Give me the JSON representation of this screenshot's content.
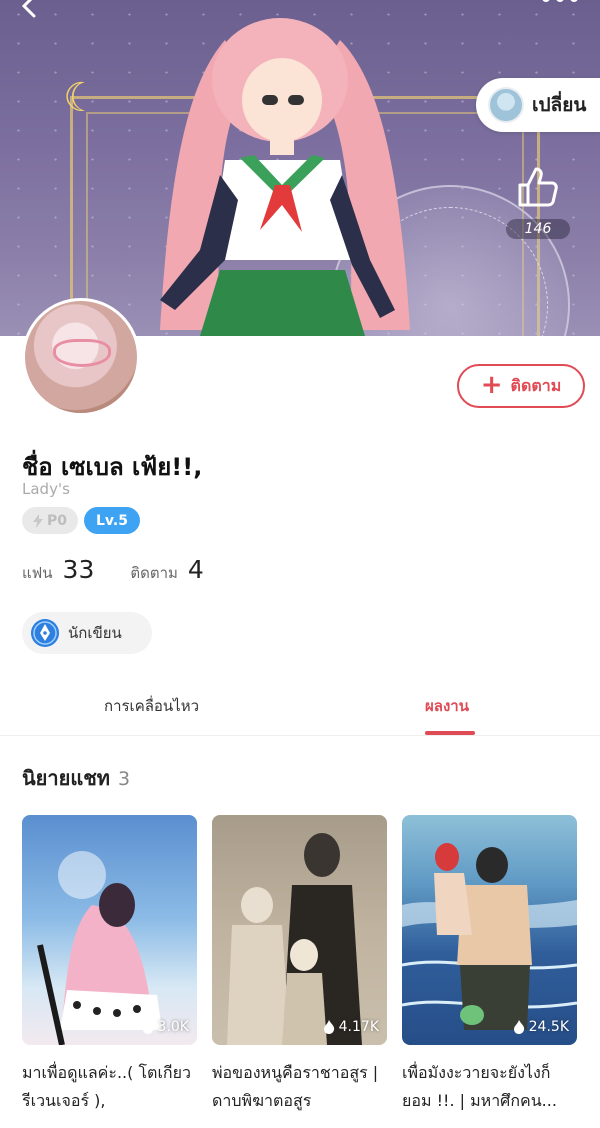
{
  "header": {
    "switch_label": "เปลี่ยน",
    "like_count": "146"
  },
  "profile": {
    "name": "ชื่อ เซเบล เฟ้ย!!,",
    "subtitle": "Lady's",
    "badge_power": "P0",
    "badge_level": "Lv.5",
    "follow_label": "ติดตาม",
    "fans_label": "แฟน",
    "fans_count": "33",
    "following_label": "ติดตาม",
    "following_count": "4",
    "role_label": "นักเขียน"
  },
  "tabs": [
    {
      "label": "การเคลื่อนไหว",
      "active": false
    },
    {
      "label": "ผลงาน",
      "active": true
    }
  ],
  "section": {
    "title": "นิยายแชท",
    "count": "3"
  },
  "cards": [
    {
      "title": "มาเพื่อดูแลค่ะ..( โตเกียวรีเวนเจอร์ ),",
      "views": "3.0K"
    },
    {
      "title": "พ่อของหนูคือราชาอสูร | ดาบพิฆาตอสูร",
      "views": "4.17K"
    },
    {
      "title": "เพื่อมังงะวายจะยังไงก็ยอม !!. | มหาศึกคน...",
      "views": "24.5K"
    }
  ],
  "colors": {
    "accent": "#e04b55",
    "level_badge": "#3da3f2"
  }
}
